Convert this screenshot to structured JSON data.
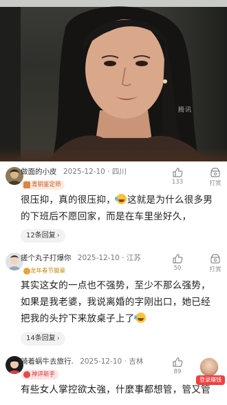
{
  "video": {
    "watermark": "腾讯"
  },
  "comments": [
    {
      "author": "做面的小皮",
      "date": "2025-12-10",
      "location": "四川",
      "badge": "青铜鉴定师",
      "text_lines": [
        "很压抑，真的很压抑，",
        "这就是为什么很多男",
        "的下班后不愿回家，而是在车里坐好久，"
      ],
      "replies": "12条回复",
      "like_count": "133",
      "reward_label": "打赏"
    },
    {
      "author": "搓个丸子打爆你",
      "date": "2025-12-10",
      "location": "江苏",
      "badge": "龙年春节徽章",
      "text_lines": [
        "其实这女的一点也不强势，至少不那么强势，",
        "如果是我老婆，我说离婚的字刚出口，她已经",
        "把我的头拧下来放桌子上了"
      ],
      "replies": "14条回复",
      "like_count": "50",
      "reward_label": "打赏"
    },
    {
      "author": "骑着蜗牛去旅行.",
      "date": "2025-12-10",
      "location": "吉林",
      "badge": "神评新手",
      "text_lines": [
        "有些女人掌控欲太強，什麼事都想管，管又管"
      ],
      "like_count": "89",
      "reward_label": "打赏"
    }
  ],
  "login_button": "登录赚钱",
  "colors": {
    "badge_copper": "#c2622a",
    "badge_new": "#d83a3a",
    "login_bg": "#f23f3f"
  },
  "icons": [
    "thumb-up-icon",
    "reward-icon",
    "emoji-laugh-cry-icon",
    "chevron-right-icon"
  ]
}
